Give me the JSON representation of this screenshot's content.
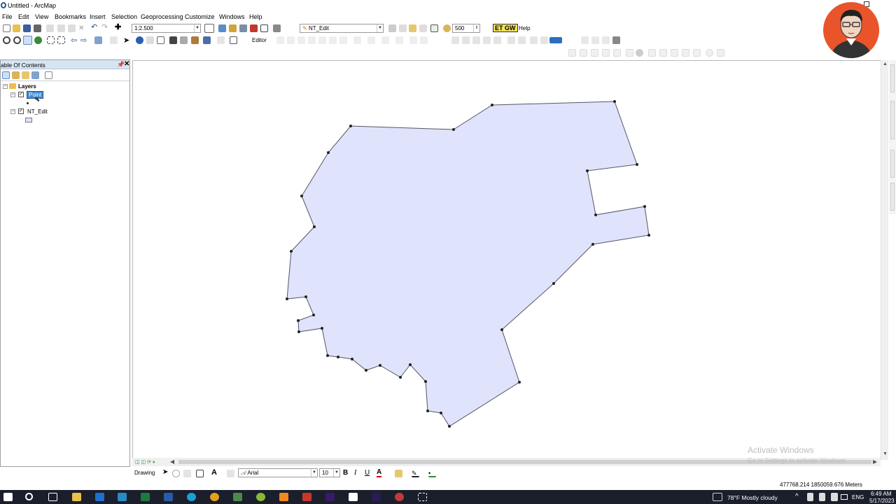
{
  "window": {
    "title": "Untitled - ArcMap"
  },
  "menu": [
    "File",
    "Edit",
    "View",
    "Bookmarks",
    "Insert",
    "Selection",
    "Geoprocessing",
    "Customize",
    "Windows",
    "Help"
  ],
  "toolbar": {
    "scale_value": "1:2.500",
    "target_layer": "NT_Edit",
    "snap_value": "500",
    "etgw_label": "ET GW",
    "help_label": "Help",
    "editor_label": "Editor"
  },
  "toc": {
    "title": "able Of Contents",
    "group_label": "Layers",
    "layers": [
      {
        "name": "Point",
        "checked": true,
        "selected": true
      },
      {
        "name": "NT_Edit",
        "checked": true,
        "selected": false
      }
    ]
  },
  "drawing": {
    "label": "Drawing",
    "font_name": "Arial",
    "font_size": "10",
    "bold": "B",
    "italic": "I",
    "underline": "U",
    "text_tool": "A"
  },
  "status": {
    "coordinates": "477768.214  1850059.676 Meters"
  },
  "watermark": {
    "line1": "Activate Windows",
    "line2": "Go to Settings to activate Windows."
  },
  "taskbar": {
    "weather": "78°F  Mostly cloudy",
    "language": "ENG",
    "time": "6:49 AM",
    "date": "5/17/2023"
  },
  "colors": {
    "polygon_fill": "#dfe3fb",
    "polygon_stroke": "#555566",
    "vertex": "#222222",
    "toc_header": "#d7e4f2",
    "taskbar": "#1b1f2b",
    "avatar_bg": "#e9542a"
  }
}
